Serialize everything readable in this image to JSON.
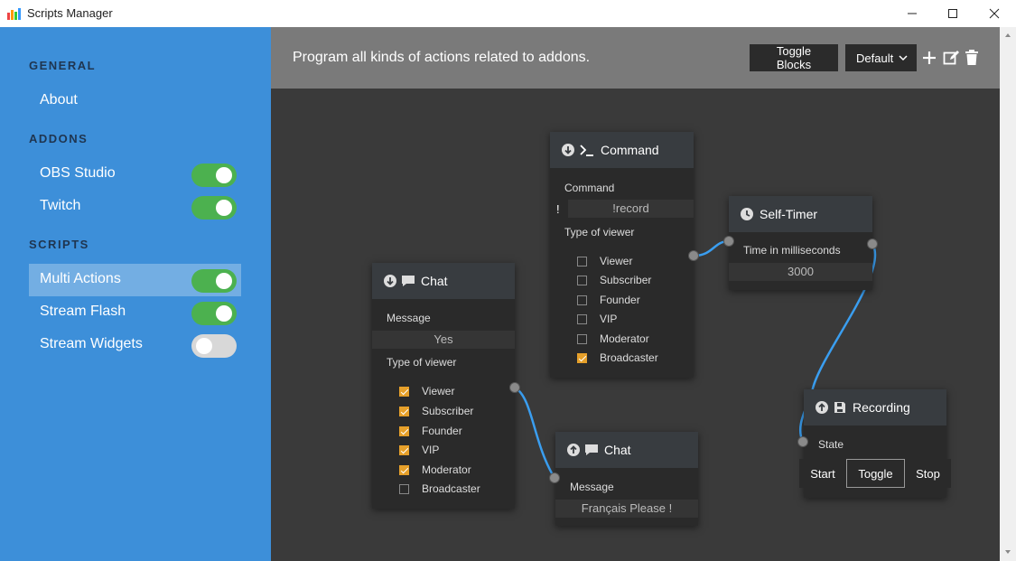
{
  "window": {
    "title": "Scripts Manager"
  },
  "sidebar": {
    "sections": {
      "general": "GENERAL",
      "addons": "ADDONS",
      "scripts": "SCRIPTS"
    },
    "items": {
      "about": "About",
      "obs": "OBS Studio",
      "twitch": "Twitch",
      "multi_actions": "Multi Actions",
      "stream_flash": "Stream Flash",
      "stream_widgets": "Stream Widgets"
    },
    "toggles": {
      "obs": true,
      "twitch": true,
      "multi_actions": true,
      "stream_flash": true,
      "stream_widgets": false
    }
  },
  "toolbar": {
    "tagline": "Program all kinds of actions related to addons.",
    "toggle_blocks": "Toggle Blocks",
    "preset": "Default"
  },
  "nodes": {
    "command": {
      "title": "Command",
      "command_label": "Command",
      "prefix": "!",
      "command_value": "!record",
      "viewer_label": "Type of viewer",
      "viewers": [
        {
          "label": "Viewer",
          "checked": false
        },
        {
          "label": "Subscriber",
          "checked": false
        },
        {
          "label": "Founder",
          "checked": false
        },
        {
          "label": "VIP",
          "checked": false
        },
        {
          "label": "Moderator",
          "checked": false
        },
        {
          "label": "Broadcaster",
          "checked": true
        }
      ]
    },
    "timer": {
      "title": "Self-Timer",
      "label": "Time in milliseconds",
      "value": "3000"
    },
    "chat1": {
      "title": "Chat",
      "message_label": "Message",
      "message_value": "Yes",
      "viewer_label": "Type of viewer",
      "viewers": [
        {
          "label": "Viewer",
          "checked": true
        },
        {
          "label": "Subscriber",
          "checked": true
        },
        {
          "label": "Founder",
          "checked": true
        },
        {
          "label": "VIP",
          "checked": true
        },
        {
          "label": "Moderator",
          "checked": true
        },
        {
          "label": "Broadcaster",
          "checked": false
        }
      ]
    },
    "chat2": {
      "title": "Chat",
      "message_label": "Message",
      "message_value": "Français Please !"
    },
    "recording": {
      "title": "Recording",
      "state_label": "State",
      "buttons": {
        "start": "Start",
        "toggle": "Toggle",
        "stop": "Stop"
      }
    }
  },
  "colors": {
    "sidebar": "#3d8fd9",
    "toggle_on": "#4cb14f",
    "wire": "#3a9ef0",
    "checkbox": "#e6a02a"
  }
}
